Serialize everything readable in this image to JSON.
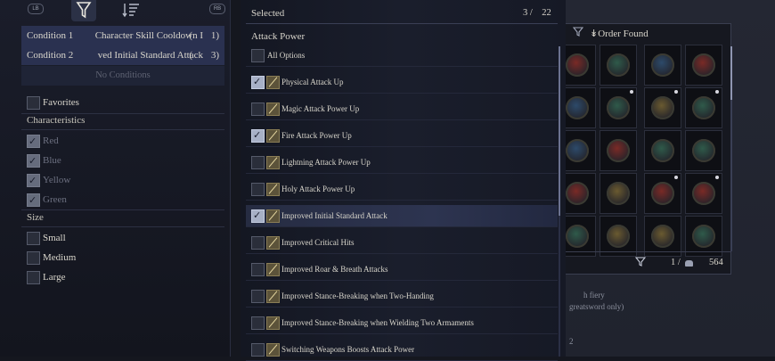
{
  "left_panel": {
    "tabs": {
      "lb": "LB",
      "rb": "RB",
      "filter_icon": "funnel-icon",
      "sort_icon": "sort-icon"
    },
    "conditions": [
      {
        "label": "Condition 1",
        "value": "Character Skill Cooldown I",
        "paren": "(",
        "count": "1)"
      },
      {
        "label": "Condition 2",
        "value": "ved Initial Standard Attack",
        "paren": "(",
        "count": "3)"
      }
    ],
    "no_conditions": "No Conditions",
    "favorites": {
      "label": "Favorites",
      "checked": false
    },
    "characteristics": {
      "title": "Characteristics",
      "items": [
        {
          "label": "Red",
          "checked": true
        },
        {
          "label": "Blue",
          "checked": true
        },
        {
          "label": "Yellow",
          "checked": true
        },
        {
          "label": "Green",
          "checked": true
        }
      ]
    },
    "size": {
      "title": "Size",
      "items": [
        {
          "label": "Small",
          "checked": false
        },
        {
          "label": "Medium",
          "checked": false
        },
        {
          "label": "Large",
          "checked": false
        }
      ]
    }
  },
  "options_panel": {
    "header": "Selected",
    "selected_count": "3",
    "separator": "/",
    "total_count": "22",
    "category": "Attack Power",
    "items": [
      {
        "label": "All Options",
        "checked": false,
        "has_icon": false
      },
      {
        "label": "Physical Attack Up",
        "checked": true,
        "has_icon": true
      },
      {
        "label": "Magic Attack Power Up",
        "checked": false,
        "has_icon": true
      },
      {
        "label": "Fire Attack Power Up",
        "checked": true,
        "has_icon": true
      },
      {
        "label": "Lightning Attack Power Up",
        "checked": false,
        "has_icon": true
      },
      {
        "label": "Holy Attack Power Up",
        "checked": false,
        "has_icon": true
      },
      {
        "label": "Improved Initial Standard Attack",
        "checked": true,
        "has_icon": true,
        "highlighted": true
      },
      {
        "label": "Improved Critical Hits",
        "checked": false,
        "has_icon": true
      },
      {
        "label": "Improved Roar & Breath Attacks",
        "checked": false,
        "has_icon": true
      },
      {
        "label": "Improved Stance-Breaking when Two-Handing",
        "checked": false,
        "has_icon": true
      },
      {
        "label": "Improved Stance-Breaking when Wielding Two Armaments",
        "checked": false,
        "has_icon": true
      },
      {
        "label": "Switching Weapons Boosts Attack Power",
        "checked": false,
        "has_icon": true
      }
    ]
  },
  "grid_panel": {
    "order_label": "Order Found",
    "order_icon": "sort-down-icon",
    "filter_icon": "funnel-icon",
    "footer": {
      "selected": "1",
      "separator": "/",
      "total": "564",
      "bag_icon": "pouch-icon"
    },
    "fragments": [
      "h fiery",
      "greatsword only)",
      "2"
    ],
    "colors": {
      "red": "#7a2a26",
      "green": "#2f5a4a",
      "yellow": "#6a5a30",
      "blue": "#2d4a6a"
    },
    "items": [
      {
        "color": "red",
        "star": false
      },
      {
        "color": "green",
        "star": false
      },
      {
        "color": "blue",
        "star": false
      },
      {
        "color": "red",
        "star": false
      },
      {
        "color": "blue",
        "star": false
      },
      {
        "color": "green",
        "star": true
      },
      {
        "color": "yellow",
        "star": true
      },
      {
        "color": "green",
        "star": true
      },
      {
        "color": "blue",
        "star": false
      },
      {
        "color": "red",
        "star": false
      },
      {
        "color": "green",
        "star": false
      },
      {
        "color": "green",
        "star": false
      },
      {
        "color": "red",
        "star": false
      },
      {
        "color": "yellow",
        "star": false
      },
      {
        "color": "red",
        "star": true
      },
      {
        "color": "red",
        "star": true
      },
      {
        "color": "green",
        "star": false
      },
      {
        "color": "yellow",
        "star": false
      },
      {
        "color": "yellow",
        "star": false
      },
      {
        "color": "green",
        "star": false
      }
    ]
  }
}
